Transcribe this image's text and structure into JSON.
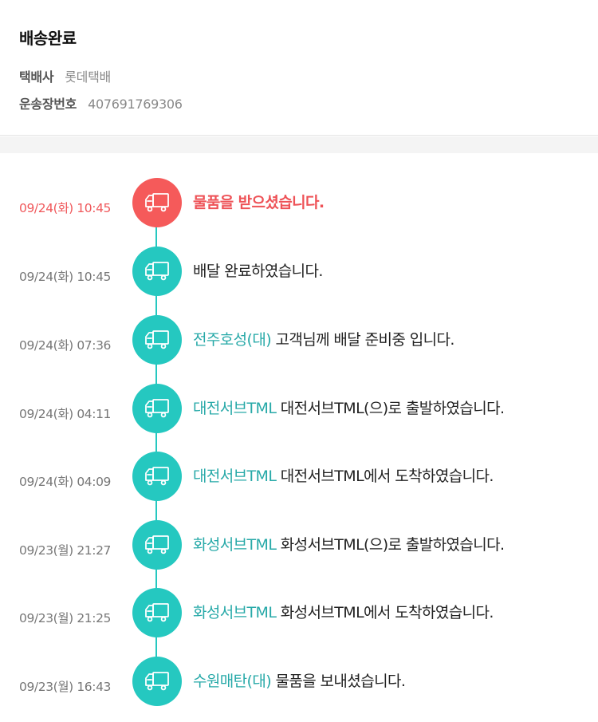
{
  "header": {
    "status": "배송완료",
    "carrier_label": "택배사",
    "carrier_value": "롯데택배",
    "tracking_label": "운송장번호",
    "tracking_value": "407691769306"
  },
  "colors": {
    "accent": "#25c8c0",
    "highlight": "#f55a5a",
    "location_text": "#27a9a8"
  },
  "icons": {
    "event": "delivery-truck-icon"
  },
  "events": [
    {
      "time": "09/24(화) 10:45",
      "location": "",
      "message": "물품을 받으셨습니다."
    },
    {
      "time": "09/24(화) 10:45",
      "location": "",
      "message": "배달 완료하였습니다."
    },
    {
      "time": "09/24(화) 07:36",
      "location": "전주호성(대)",
      "message": " 고객님께 배달 준비중 입니다."
    },
    {
      "time": "09/24(화) 04:11",
      "location": "대전서브TML",
      "message": " 대전서브TML(으)로 출발하였습니다."
    },
    {
      "time": "09/24(화) 04:09",
      "location": "대전서브TML",
      "message": " 대전서브TML에서 도착하였습니다."
    },
    {
      "time": "09/23(월) 21:27",
      "location": "화성서브TML",
      "message": " 화성서브TML(으)로 출발하였습니다."
    },
    {
      "time": "09/23(월) 21:25",
      "location": "화성서브TML",
      "message": " 화성서브TML에서 도착하였습니다."
    },
    {
      "time": "09/23(월) 16:43",
      "location": "수원매탄(대)",
      "message": " 물품을 보내셨습니다."
    }
  ]
}
